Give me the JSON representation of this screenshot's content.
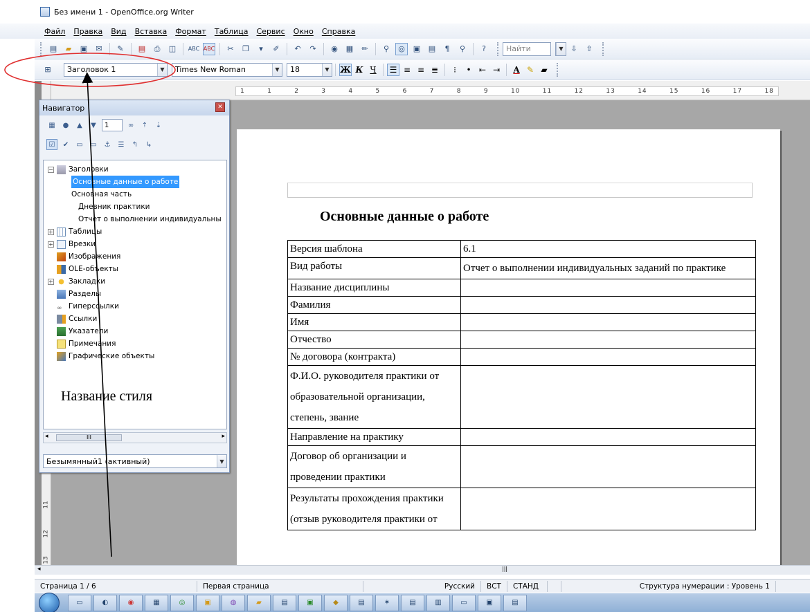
{
  "window": {
    "title": "Без имени 1 - OpenOffice.org Writer"
  },
  "menu": [
    "Файл",
    "Правка",
    "Вид",
    "Вставка",
    "Формат",
    "Таблица",
    "Сервис",
    "Окно",
    "Справка"
  ],
  "toolbar": {
    "find_placeholder": "Найти",
    "style_value": "Заголовок 1",
    "font_value": "Times New Roman",
    "size_value": "18",
    "bold": "Ж",
    "italic": "К",
    "underline": "Ч"
  },
  "ruler": {
    "numbers": [
      "1",
      "1",
      "2",
      "3",
      "4",
      "5",
      "6",
      "7",
      "8",
      "9",
      "10",
      "11",
      "12",
      "13",
      "14",
      "15",
      "16",
      "17",
      "18"
    ],
    "vertical": [
      "11",
      "12",
      "13"
    ]
  },
  "navigator": {
    "title": "Навигатор",
    "page_number": "1",
    "tree": {
      "headings": "Заголовки",
      "h1": "Основные данные о работе",
      "h2": "Основная часть",
      "h3": "Дневник практики",
      "h4": "Отчет о выполнении индивидуальны",
      "tables": "Таблицы",
      "frames": "Врезки",
      "images": "Изображения",
      "ole": "OLE-объекты",
      "bookmarks": "Закладки",
      "sections": "Разделы",
      "hyperlinks": "Гиперссылки",
      "references": "Ссылки",
      "indexes": "Указатели",
      "comments": "Примечания",
      "drawing": "Графические объекты"
    },
    "annotation": "Название стиля",
    "scroll_thumb": "III",
    "document": "Безымянный1 (активный)"
  },
  "document": {
    "heading": "Основные данные о работе",
    "rows": [
      [
        "Версия шаблона",
        "6.1"
      ],
      [
        "Вид работы",
        "Отчет о выполнении индивидуальных заданий по практике"
      ],
      [
        "Название дисциплины",
        ""
      ],
      [
        "Фамилия",
        ""
      ],
      [
        "Имя",
        ""
      ],
      [
        "Отчество",
        ""
      ],
      [
        "№ договора (контракта)",
        ""
      ],
      [
        "Ф.И.О. руководителя практики от образовательной организации, степень, звание",
        ""
      ],
      [
        "Направление на практику",
        ""
      ],
      [
        "Договор об организации и проведении практики",
        ""
      ],
      [
        "Результаты прохождения практики (отзыв руководителя практики от",
        ""
      ]
    ]
  },
  "statusbar": {
    "page": "Страница 1 / 6",
    "page_style": "Первая страница",
    "language": "Русский",
    "insert_mode": "ВСТ",
    "selection_mode": "СТАНД",
    "numbering": "Структура нумерации : Уровень 1"
  },
  "colors": {
    "highlight": "#3399ff",
    "annotation": "#e03030",
    "page_bg": "#a7a7a7"
  }
}
